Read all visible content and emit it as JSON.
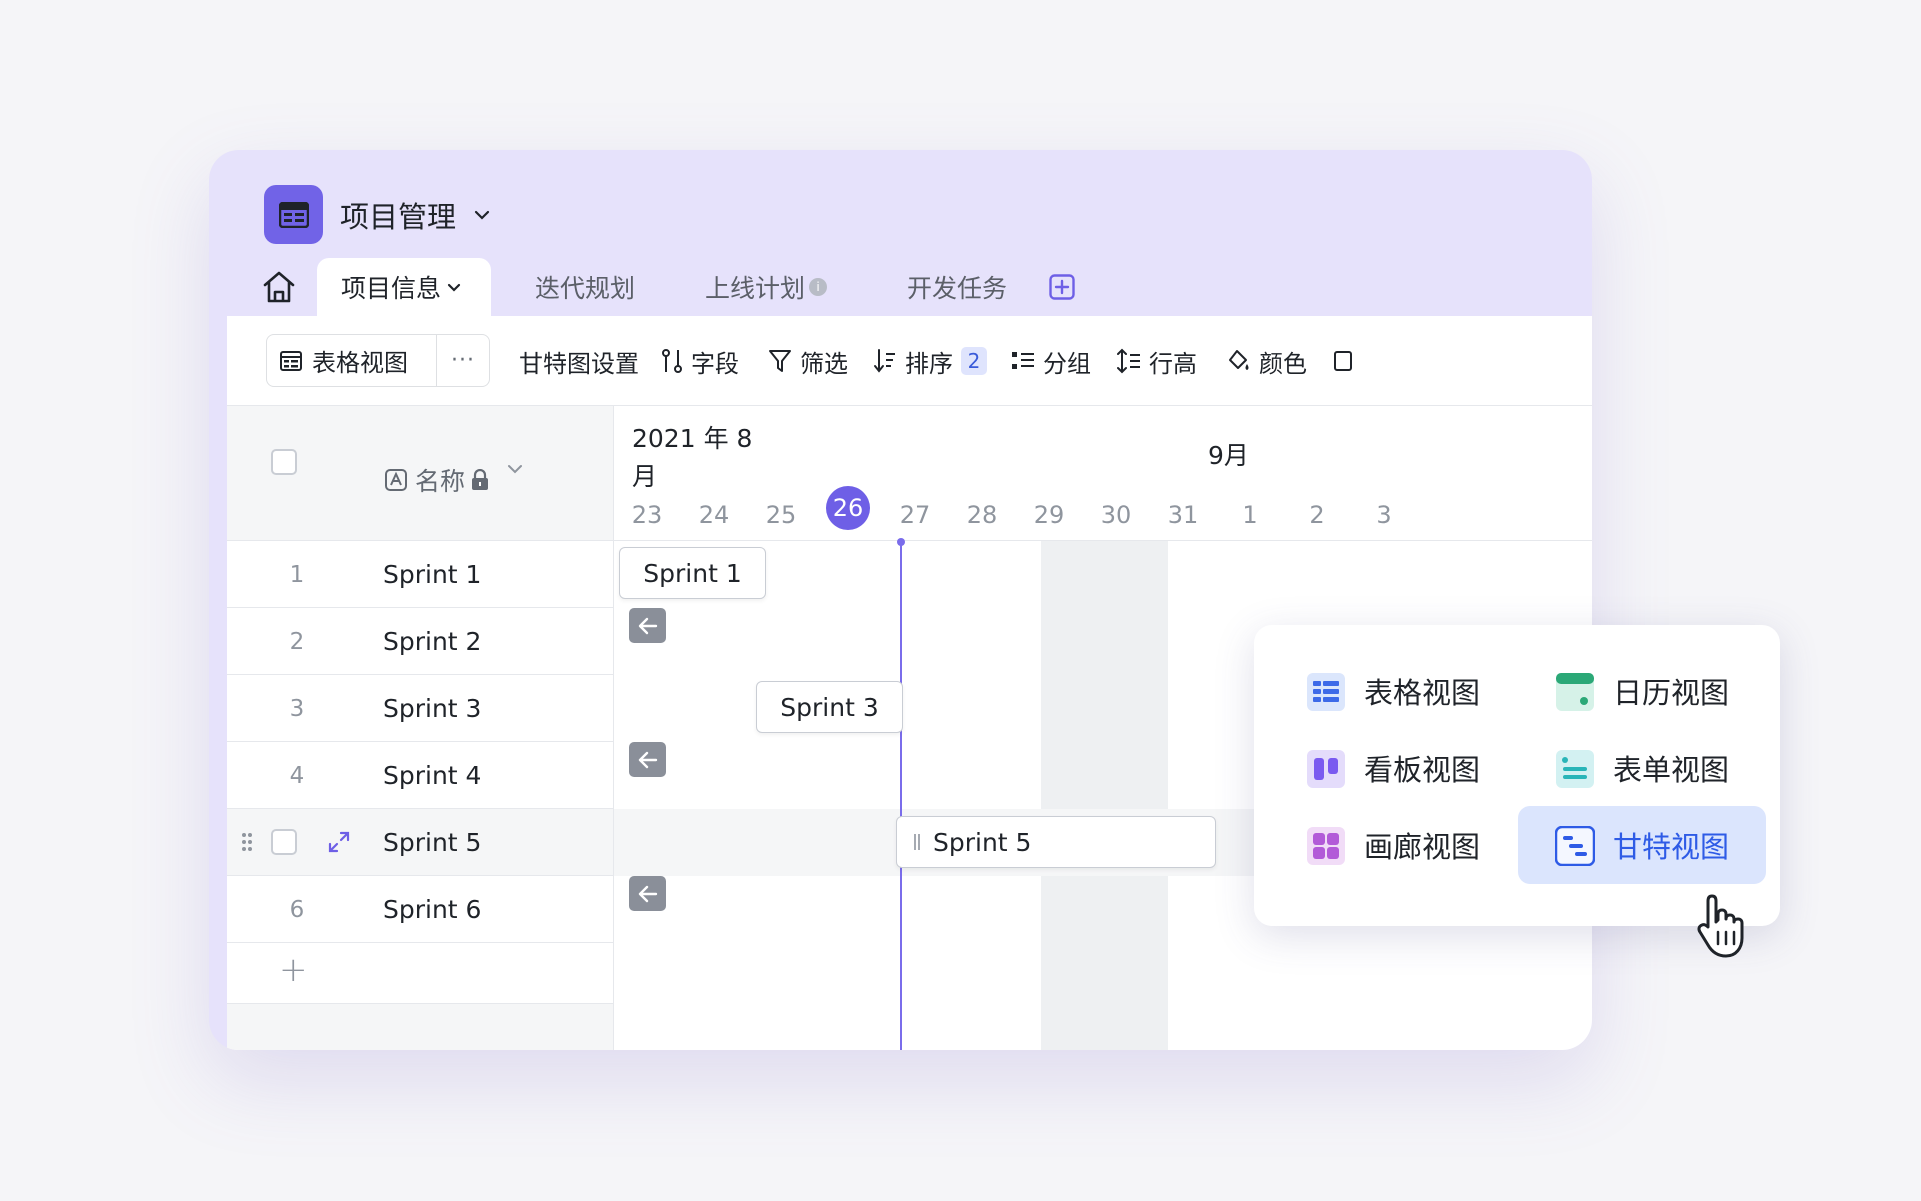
{
  "app": {
    "title": "项目管理"
  },
  "tabs": [
    {
      "label": "项目信息",
      "active": true
    },
    {
      "label": "迭代规划"
    },
    {
      "label": "上线计划",
      "info": "i"
    },
    {
      "label": "开发任务"
    }
  ],
  "toolbar": {
    "view_label": "表格视图",
    "more": "···",
    "gantt_settings": "甘特图设置",
    "fields": "字段",
    "filter": "筛选",
    "sort": "排序",
    "sort_count": "2",
    "group": "分组",
    "row_height": "行高",
    "color": "颜色"
  },
  "grid": {
    "column_name": "名称",
    "rows": [
      {
        "num": "1",
        "name": "Sprint 1"
      },
      {
        "num": "2",
        "name": "Sprint 2"
      },
      {
        "num": "3",
        "name": "Sprint 3"
      },
      {
        "num": "4",
        "name": "Sprint 4"
      },
      {
        "num": "",
        "name": "Sprint 5"
      },
      {
        "num": "6",
        "name": "Sprint 6"
      }
    ],
    "add_symbol": "+"
  },
  "gantt": {
    "month1": "2021 年 8 月",
    "month2": "9月",
    "days": [
      "23",
      "24",
      "25",
      "26",
      "27",
      "28",
      "29",
      "30",
      "31",
      "1",
      "2",
      "3"
    ],
    "today": "26",
    "bars": [
      {
        "label": "Sprint 1"
      },
      {
        "label": "Sprint 3"
      },
      {
        "label": "Sprint 5"
      }
    ]
  },
  "view_menu": {
    "items": [
      {
        "label": "表格视图",
        "icon": "grid-view-icon"
      },
      {
        "label": "日历视图",
        "icon": "calendar-view-icon"
      },
      {
        "label": "看板视图",
        "icon": "kanban-view-icon"
      },
      {
        "label": "表单视图",
        "icon": "form-view-icon"
      },
      {
        "label": "画廊视图",
        "icon": "gallery-view-icon"
      },
      {
        "label": "甘特视图",
        "icon": "gantt-view-icon",
        "selected": true
      }
    ]
  },
  "colors": {
    "accent": "#6e5fe6",
    "card_bg": "#e6e2fb",
    "selected_bg": "#dbe5fd",
    "selected_text": "#2e5be6"
  }
}
